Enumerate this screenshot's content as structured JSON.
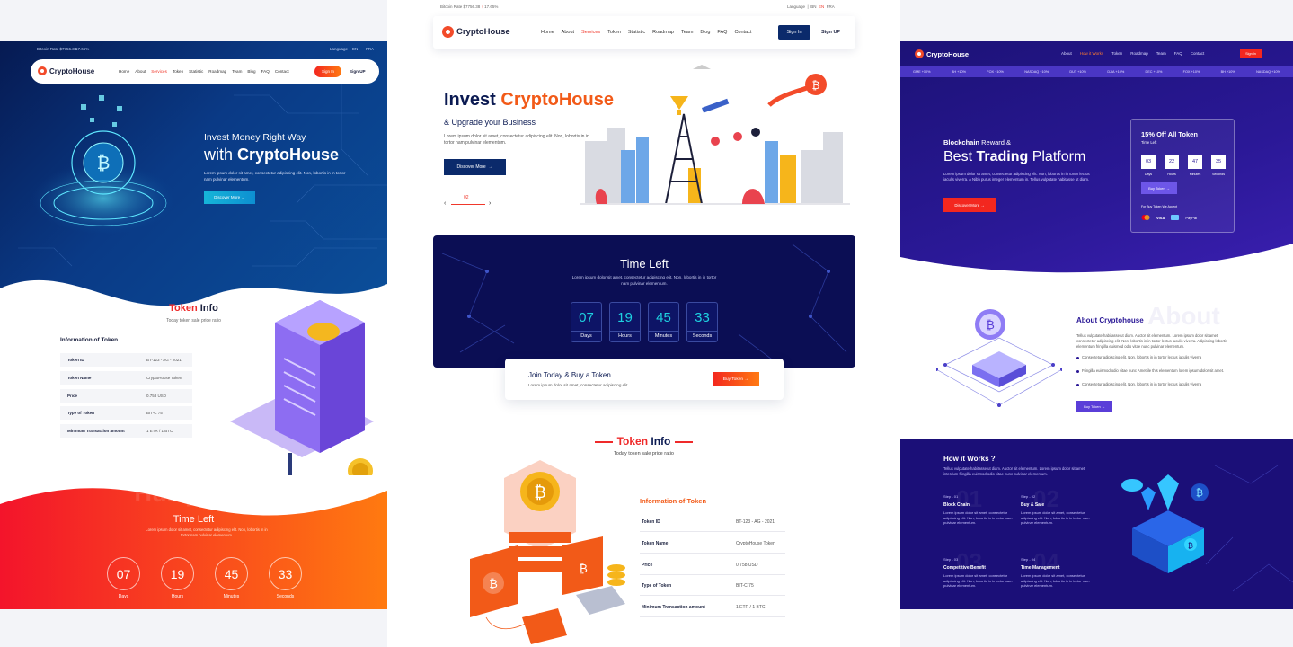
{
  "left": {
    "topbar": {
      "rate": "Bitcoin Rate $7756.38",
      "change": "17.65%",
      "language": "Language",
      "langs": [
        "EN",
        "FRA"
      ]
    },
    "nav": {
      "logo": "CryptoHouse",
      "menu": [
        "Home",
        "About",
        "Services",
        "Token",
        "Statistic",
        "Roadmap",
        "Team",
        "Blog",
        "FAQ",
        "Contact"
      ],
      "active": "Services",
      "signin": "Sign In",
      "signup": "Sign UP"
    },
    "hero": {
      "line1": "Invest Money Right Way",
      "with": "with",
      "brand": "CryptoHouse",
      "text": "Lorem ipsum dolor sit amet, consectetur adipiscing elit. Non, lobortis in in tortor  nam pulvinar elementum.",
      "button": "Discover More"
    },
    "token": {
      "title1": "Token",
      "title2": "Info",
      "subtitle": "Today token sale price ratio",
      "heading": "Information of Token",
      "rows": [
        {
          "k": "Token ID",
          "v": "BT-123 - AG - 2021"
        },
        {
          "k": "Token Name",
          "v": "CryptoHouse Token"
        },
        {
          "k": "Price",
          "v": "0.758 USD"
        },
        {
          "k": "Type of Token",
          "v": "BIT-C 75"
        },
        {
          "k": "Minimum Transaction amount",
          "v": "1 ETR / 1 BTC"
        }
      ]
    },
    "hurry": "Hurry Up !",
    "timeleft": {
      "title": "Time Left",
      "text": "Lorem ipsum dolor sit amet, consectetur adipiscing elit. Non, lobortis in in tortor  nam pulvinar elementum.",
      "counters": [
        {
          "n": "07",
          "l": "Days"
        },
        {
          "n": "19",
          "l": "Hours"
        },
        {
          "n": "45",
          "l": "Minutes"
        },
        {
          "n": "33",
          "l": "Seconds"
        }
      ]
    }
  },
  "center": {
    "topbar": {
      "rate": "Bitcoin Rate $7756.38",
      "change": "17.65%",
      "language": "Language",
      "langs": [
        "BN",
        "EN",
        "FRA"
      ],
      "active_lang": "EN"
    },
    "nav": {
      "logo": "CryptoHouse",
      "menu": [
        "Home",
        "About",
        "Services",
        "Token",
        "Statistic",
        "Roadmap",
        "Team",
        "Blog",
        "FAQ",
        "Contact"
      ],
      "active": "Services",
      "signin": "Sign In",
      "signup": "Sign UP"
    },
    "hero": {
      "invest": "Invest",
      "brand": "CryptoHouse",
      "sub": "& Upgrade your Business",
      "text": "Lorem ipsum dolor sit amet, consectetur adipiscing elit. Non, lobortis in in tortor  nam pulvinar elementum.",
      "button": "Discover More",
      "slide": "02"
    },
    "timeleft": {
      "title": "Time Left",
      "text": "Lorem ipsum dolor sit amet, consectetur adipiscing elit. Non, lobortis in in tortor  nam pulvinar elementum.",
      "counters": [
        {
          "n": "07",
          "l": "Days"
        },
        {
          "n": "19",
          "l": "Hours"
        },
        {
          "n": "45",
          "l": "Minutes"
        },
        {
          "n": "33",
          "l": "Seconds"
        }
      ]
    },
    "join": {
      "title": "Join Today & Buy a Token",
      "text": "Lorem ipsum dolor sit amet, consectetur adipiscing elit.",
      "button": "Buy Token"
    },
    "token": {
      "title1": "Token",
      "title2": "Info",
      "subtitle": "Today token sale price ratio",
      "heading": "Information of Token",
      "rows": [
        {
          "k": "Token ID",
          "v": "BT-123 - AG - 2021"
        },
        {
          "k": "Token Name",
          "v": "CryptoHouse Token"
        },
        {
          "k": "Price",
          "v": "0.758 USD"
        },
        {
          "k": "Type of Token",
          "v": "BIT-C 75"
        },
        {
          "k": "Minimum Transaction amount",
          "v": "1 ETR / 1 BTC"
        }
      ]
    }
  },
  "right": {
    "nav": {
      "logo": "CryptoHouse",
      "menu": [
        "About",
        "How it Works",
        "Token",
        "Roadmap",
        "Team",
        "FAQ",
        "Contact"
      ],
      "active": "How it Works",
      "signin": "Sign In"
    },
    "ticker": [
      "GME +10%",
      "BH +10%",
      "FOX +10%",
      "NASDAQ +10%",
      "DUT +10%",
      "DJIA +10%",
      "DEC +10%",
      "FOX +10%",
      "BH +10%",
      "NASDAQ +10%"
    ],
    "hero": {
      "kicker1": "Blockchain",
      "kicker2": "Reward &",
      "t1": "Best",
      "t2": "Trading",
      "t3": "Platform",
      "text": "Lorem ipsum dolor sit amet, consectetur adipiscing elit. Non, lobortis in in tortor lectus iaculis viverra. A Nibh purus integer elementum in. Tellus vulputate habitasse ut diam.",
      "button": "Discover More"
    },
    "card": {
      "title": "15% Off All Token",
      "sub": "Time Left",
      "counters": [
        {
          "n": "03",
          "l": "Days"
        },
        {
          "n": "22",
          "l": "Hours"
        },
        {
          "n": "47",
          "l": "Minutes"
        },
        {
          "n": "35",
          "l": "Seconds"
        }
      ],
      "button": "Buy Token",
      "accept": "For Buy Token We Accept",
      "pay": [
        "VISA",
        "PayPal"
      ]
    },
    "about": {
      "title": "About Cryptohouse",
      "bg": "About",
      "text": "Tellus vulputate habitasse ut diam. Auctor sit elementum. Lorem ipsum dolor sit amet, consectetur adipiscing elit. Non, lobortis in in tortor lectus iaculis viverra. Adipiscing lobortis elementum fringilla euismod odio vitae nunc pulvinar elementum.",
      "list": [
        "Consectetur adipiscing elit. Non, lobortis in in tortor lectus iaculis viverra",
        "Fringilla euismod odio vitae nunc Amet ile this elementum lorem ipsum dolor sit amet.",
        "Consectetur adipiscing elit. Non, lobortis in in tortor lectus iaculis viverra"
      ],
      "button": "Buy Token"
    },
    "how": {
      "title": "How it Works ?",
      "text": "Tellus vulputate habitasse ut diam. Auctor sit elementum. Lorem ipsum dolor sit amet, interdum fringilla euismod odio vitae nunc pulvinar elementum.",
      "steps": [
        {
          "n": "Step - 01",
          "big": "01",
          "h": "Block Chain",
          "d": "Lorem ipsum dolor sit amet, consectetur adipiscing elit. Non, lobortis in in tortor  nam pulvinar elementum."
        },
        {
          "n": "Step - 02",
          "big": "02",
          "h": "Buy & Sale",
          "d": "Lorem ipsum dolor sit amet, consectetur adipiscing elit. Non, lobortis in in tortor  nam pulvinar elementum."
        },
        {
          "n": "Step - 03",
          "big": "03",
          "h": "Competitive Benefit",
          "d": "Lorem ipsum dolor sit amet, consectetur adipiscing elit. Non, lobortis in in tortor  nam pulvinar elementum."
        },
        {
          "n": "Step - 04",
          "big": "04",
          "h": "Time Management",
          "d": "Lorem ipsum dolor sit amet, consectetur adipiscing elit. Non, lobortis in in tortor  nam pulvinar elementum."
        }
      ]
    }
  }
}
